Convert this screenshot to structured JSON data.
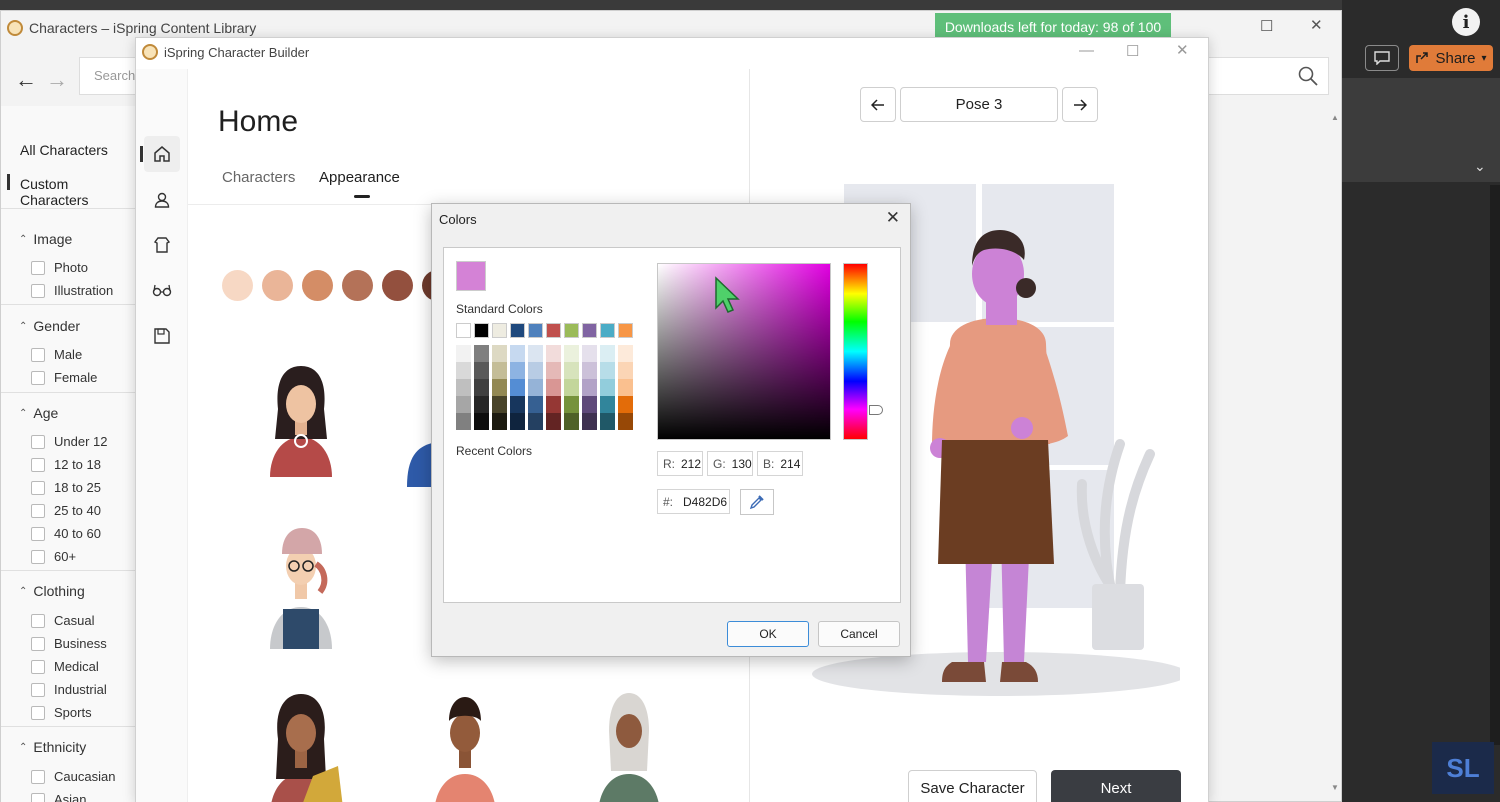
{
  "library": {
    "title": "Characters – iSpring Content Library",
    "downloads_banner": "Downloads left for today: 98 of 100",
    "search_placeholder": "Search",
    "nav": {
      "all": "All Characters",
      "custom": "Custom Characters"
    },
    "filters": [
      {
        "title": "Image",
        "options": [
          "Photo",
          "Illustration"
        ]
      },
      {
        "title": "Gender",
        "options": [
          "Male",
          "Female"
        ]
      },
      {
        "title": "Age",
        "options": [
          "Under 12",
          "12 to 18",
          "18 to 25",
          "25 to 40",
          "40 to 60",
          "60+"
        ]
      },
      {
        "title": "Clothing",
        "options": [
          "Casual",
          "Business",
          "Medical",
          "Industrial",
          "Sports"
        ]
      },
      {
        "title": "Ethnicity",
        "options": [
          "Caucasian",
          "Asian"
        ]
      }
    ]
  },
  "powerpoint": {
    "share_label": "Share",
    "info_glyph": "i",
    "logo_text": "SL"
  },
  "builder": {
    "title": "iSpring Character Builder",
    "heading": "Home",
    "tabs": [
      "Characters",
      "Appearance"
    ],
    "active_tab": "Appearance",
    "skin_tones": [
      "#f7d8c4",
      "#eab598",
      "#d48d66",
      "#b47258",
      "#93503e",
      "#6d3a2c"
    ],
    "pose_label": "Pose 3",
    "save_label": "Save Character",
    "next_label": "Next",
    "character_colors": {
      "skin": "#cc82d6",
      "hair": "#3a2a28",
      "blouse": "#e69a80",
      "skirt": "#6b3d22",
      "pants": "#c585d5",
      "shoes": "#7a4a38"
    }
  },
  "colors_dialog": {
    "title": "Colors",
    "current_color": "#d482d6",
    "standard_label": "Standard Colors",
    "recent_label": "Recent Colors",
    "standard_colors": [
      "#ffffff",
      "#000000",
      "#eeece1",
      "#1f497d",
      "#4f81bd",
      "#c0504d",
      "#9bbb59",
      "#8064a2",
      "#4bacc6",
      "#f79646"
    ],
    "shade_columns": [
      [
        "#f2f2f2",
        "#d9d9d9",
        "#bfbfbf",
        "#a6a6a6",
        "#808080"
      ],
      [
        "#7f7f7f",
        "#595959",
        "#404040",
        "#262626",
        "#0d0d0d"
      ],
      [
        "#ddd9c3",
        "#c4bd97",
        "#938953",
        "#494429",
        "#1d1b10"
      ],
      [
        "#c6d9f0",
        "#8db3e2",
        "#548dd4",
        "#17365d",
        "#0f243e"
      ],
      [
        "#dbe5f1",
        "#b8cce4",
        "#95b3d7",
        "#366092",
        "#244061"
      ],
      [
        "#f2dcdb",
        "#e5b9b7",
        "#d99694",
        "#953734",
        "#632423"
      ],
      [
        "#ebf1dd",
        "#d7e3bc",
        "#c3d69b",
        "#76923c",
        "#4f6128"
      ],
      [
        "#e5e0ec",
        "#ccc1d9",
        "#b2a2c7",
        "#5f497a",
        "#3f3151"
      ],
      [
        "#dbeef3",
        "#b7dde8",
        "#92cddc",
        "#31859b",
        "#205867"
      ],
      [
        "#fdeada",
        "#fbd5b5",
        "#fac08f",
        "#e36c09",
        "#974806"
      ]
    ],
    "r_label": "R:",
    "r": "212",
    "g_label": "G:",
    "g": "130",
    "b_label": "B:",
    "b": "214",
    "hex_label": "#:",
    "hex": "D482D6",
    "ok_label": "OK",
    "cancel_label": "Cancel"
  }
}
